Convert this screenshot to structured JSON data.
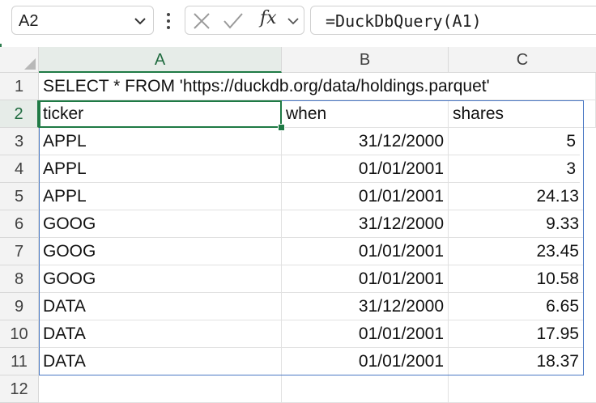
{
  "name_box": {
    "value": "A2"
  },
  "formula_bar": {
    "fx_label": "fx",
    "formula": "=DuckDbQuery(A1)"
  },
  "columns": [
    "A",
    "B",
    "C"
  ],
  "rows": [
    {
      "num": "1",
      "a": "SELECT * FROM 'https://duckdb.org/data/holdings.parquet'",
      "b": "",
      "c": ""
    },
    {
      "num": "2",
      "a": "ticker",
      "b": "when",
      "c": "shares"
    },
    {
      "num": "3",
      "a": "APPL",
      "b": "31/12/2000",
      "c": "5"
    },
    {
      "num": "4",
      "a": "APPL",
      "b": "01/01/2001",
      "c": "3"
    },
    {
      "num": "5",
      "a": "APPL",
      "b": "01/01/2001",
      "c": "24.13"
    },
    {
      "num": "6",
      "a": "GOOG",
      "b": "31/12/2000",
      "c": "9.33"
    },
    {
      "num": "7",
      "a": "GOOG",
      "b": "01/01/2001",
      "c": "23.45"
    },
    {
      "num": "8",
      "a": "GOOG",
      "b": "01/01/2001",
      "c": "10.58"
    },
    {
      "num": "9",
      "a": "DATA",
      "b": "31/12/2000",
      "c": "6.65"
    },
    {
      "num": "10",
      "a": "DATA",
      "b": "01/01/2001",
      "c": "17.95"
    },
    {
      "num": "11",
      "a": "DATA",
      "b": "01/01/2001",
      "c": "18.37"
    },
    {
      "num": "12",
      "a": "",
      "b": "",
      "c": ""
    }
  ],
  "colors": {
    "accent": "#1f7a45",
    "spill_border": "#4a78c4"
  }
}
